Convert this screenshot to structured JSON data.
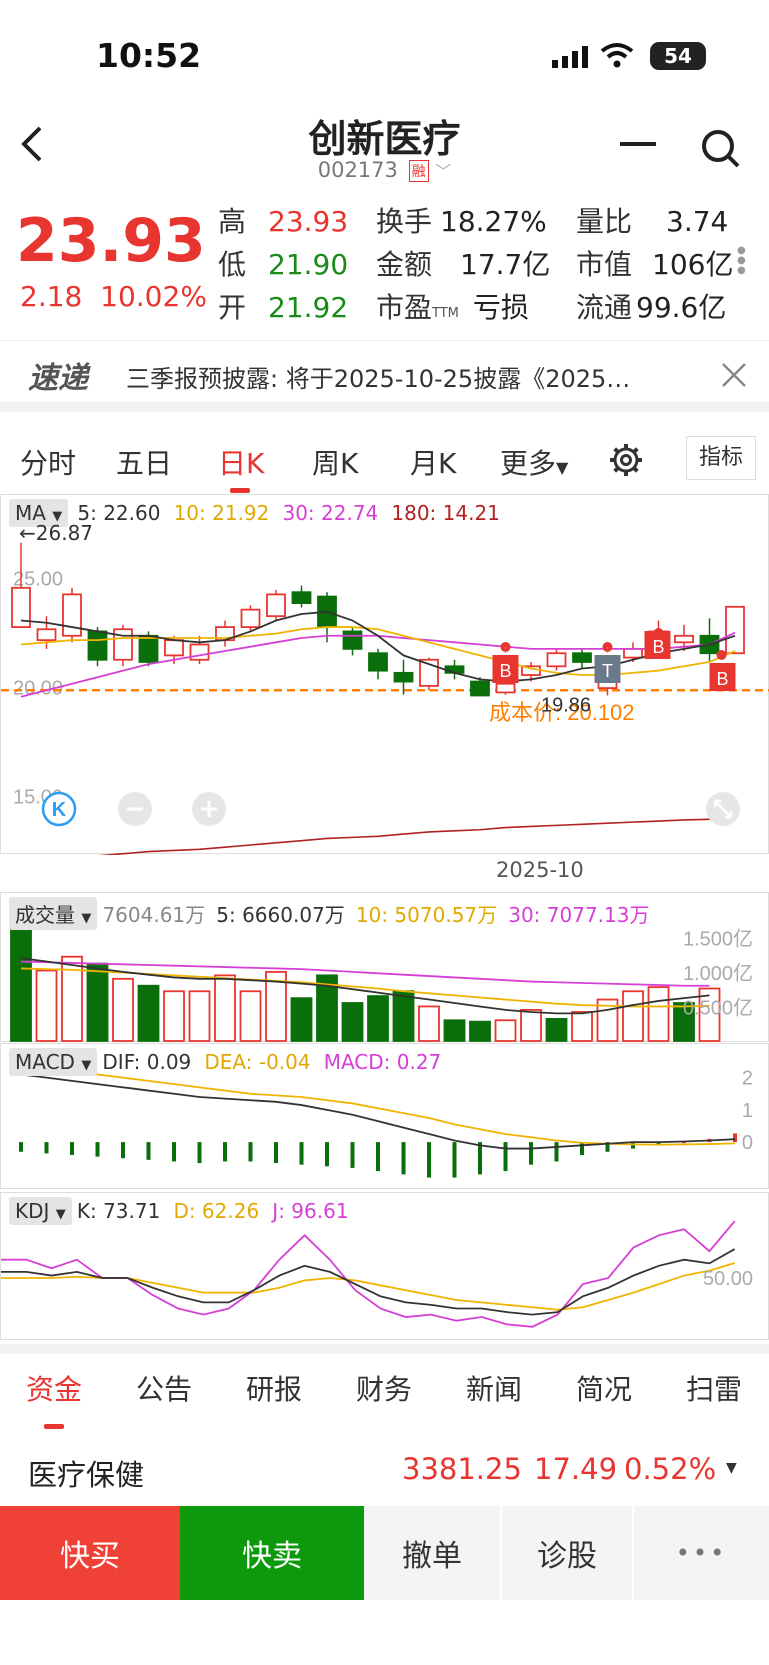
{
  "status_bar": {
    "time": "10:52",
    "battery": "54"
  },
  "header": {
    "title": "创新医疗",
    "code": "002173",
    "tag": "融",
    "back_icon": "chevron-left-icon",
    "minus_icon": "minus-icon",
    "search_icon": "search-icon"
  },
  "quote": {
    "price": "23.93",
    "change": "2.18",
    "change_pct": "10.02%",
    "items": [
      {
        "label": "高",
        "value": "23.93"
      },
      {
        "label": "低",
        "value": "21.90"
      },
      {
        "label": "开",
        "value": "21.92"
      },
      {
        "label": "换手",
        "value": "18.27%"
      },
      {
        "label": "金额",
        "value": "17.7亿"
      },
      {
        "label": "市盈",
        "sub": "TTM",
        "value": "亏损"
      },
      {
        "label": "量比",
        "value": "3.74"
      },
      {
        "label": "市值",
        "value": "106亿"
      },
      {
        "label": "流通",
        "value": "99.6亿"
      }
    ]
  },
  "banner": {
    "logo": "速递",
    "text": "三季报预披露: 将于2025-10-25披露《2025…"
  },
  "chart_tabs": [
    "分时",
    "五日",
    "日K",
    "周K",
    "月K",
    "更多"
  ],
  "indicator_button": "指标",
  "ma_legend": {
    "label": "MA",
    "ma5": "5: 22.60",
    "ma10": "10: 21.92",
    "ma30": "30: 22.74",
    "ma180": "180: 14.21"
  },
  "annotations": {
    "high_marker": "26.87",
    "low_marker": "19.86",
    "cost": "成本价: 20.102",
    "b_marker": "B",
    "t_marker": "T",
    "date": "2025-10"
  },
  "vol_legend": {
    "label": "成交量",
    "vol": "7604.61万",
    "ma5": "5: 6660.07万",
    "ma10": "10: 5070.57万",
    "ma30": "30: 7077.13万"
  },
  "macd_legend": {
    "label": "MACD",
    "dif": "DIF: 0.09",
    "dea": "DEA: -0.04",
    "macd": "MACD: 0.27"
  },
  "kdj_legend": {
    "label": "KDJ",
    "k": "K: 73.71",
    "d": "D: 62.26",
    "j": "J: 96.61"
  },
  "bottom_tabs": [
    "资金",
    "公告",
    "研报",
    "财务",
    "新闻",
    "简况",
    "扫雷"
  ],
  "sector": {
    "name": "医疗保健",
    "price": "3381.25",
    "change": "17.49",
    "pct": "0.52%"
  },
  "actions": {
    "buy": "快买",
    "sell": "快卖",
    "cancel": "撤单",
    "diagnose": "诊股",
    "more": "•••"
  },
  "colors": {
    "up": "#e8352f",
    "down": "#0a6e0a",
    "ma5": "#333333",
    "ma10": "#f0b400",
    "ma30": "#d63fd6",
    "ma180": "#b22222",
    "cost": "#ff7f00"
  },
  "chart_data": [
    {
      "type": "candlestick",
      "title": "",
      "y_ticks": [
        "25.00",
        "20.00",
        "15.00"
      ],
      "ylim": [
        13.0,
        27.5
      ],
      "x_label": "2025-10",
      "candles": [
        [
          23.0,
          24.8,
          23.1,
          26.87
        ],
        [
          22.4,
          22.9,
          22.0,
          23.5
        ],
        [
          22.6,
          24.5,
          22.3,
          24.8
        ],
        [
          22.8,
          21.5,
          21.2,
          23.0
        ],
        [
          21.5,
          22.9,
          21.2,
          23.1
        ],
        [
          22.6,
          21.4,
          21.2,
          22.8
        ],
        [
          21.7,
          22.4,
          21.3,
          22.6
        ],
        [
          21.5,
          22.2,
          21.3,
          22.6
        ],
        [
          22.4,
          23.0,
          22.1,
          23.3
        ],
        [
          23.0,
          23.8,
          22.8,
          24.0
        ],
        [
          23.5,
          24.5,
          23.3,
          24.7
        ],
        [
          24.6,
          24.1,
          23.9,
          24.9
        ],
        [
          24.4,
          23.0,
          22.3,
          24.6
        ],
        [
          22.8,
          22.0,
          21.7,
          23.0
        ],
        [
          21.8,
          21.0,
          20.6,
          22.0
        ],
        [
          20.9,
          20.5,
          19.9,
          21.5
        ],
        [
          20.3,
          21.5,
          20.1,
          21.6
        ],
        [
          21.2,
          20.9,
          20.6,
          21.5
        ],
        [
          20.5,
          19.86,
          19.86,
          20.7
        ],
        [
          20.0,
          20.4,
          19.9,
          20.5
        ],
        [
          20.8,
          21.2,
          20.5,
          21.4
        ],
        [
          21.2,
          21.8,
          21.0,
          22.0
        ],
        [
          21.8,
          21.4,
          21.1,
          22.0
        ],
        [
          20.2,
          21.5,
          19.86,
          21.6
        ],
        [
          21.6,
          22.0,
          21.4,
          22.3
        ],
        [
          22.0,
          22.8,
          21.8,
          23.3
        ],
        [
          22.3,
          22.6,
          21.9,
          23.1
        ],
        [
          22.6,
          21.8,
          21.4,
          23.4
        ],
        [
          21.8,
          23.93,
          21.9,
          23.93
        ]
      ],
      "ma5": [
        23.3,
        23.2,
        23.0,
        22.8,
        22.6,
        22.6,
        22.4,
        22.3,
        22.4,
        22.8,
        23.3,
        23.6,
        23.7,
        23.3,
        22.6,
        21.7,
        21.3,
        20.9,
        20.6,
        20.5,
        20.6,
        20.8,
        21.1,
        21.2,
        21.5,
        21.8,
        22.0,
        22.2,
        22.6
      ],
      "ma10": [
        22.2,
        22.3,
        22.4,
        22.4,
        22.5,
        22.5,
        22.5,
        22.5,
        22.5,
        22.6,
        22.7,
        22.9,
        23.0,
        23.0,
        22.9,
        22.6,
        22.3,
        22.0,
        21.7,
        21.4,
        21.1,
        20.9,
        20.8,
        20.8,
        20.9,
        21.0,
        21.2,
        21.4,
        21.9
      ],
      "ma30": [
        19.8,
        20.1,
        20.4,
        20.7,
        21.0,
        21.3,
        21.5,
        21.7,
        21.9,
        22.1,
        22.3,
        22.5,
        22.6,
        22.6,
        22.6,
        22.5,
        22.4,
        22.3,
        22.2,
        22.1,
        22.0,
        22.0,
        22.0,
        22.0,
        22.0,
        22.0,
        22.1,
        22.2,
        22.74
      ],
      "ma180": [
        12.2,
        12.3,
        12.4,
        12.5,
        12.6,
        12.7,
        12.75,
        12.8,
        12.9,
        13.0,
        13.1,
        13.2,
        13.3,
        13.35,
        13.4,
        13.5,
        13.6,
        13.65,
        13.7,
        13.8,
        13.85,
        13.9,
        13.95,
        14.0,
        14.05,
        14.1,
        14.15,
        14.18,
        14.21
      ]
    },
    {
      "type": "bar",
      "title": "",
      "y_ticks": [
        "1.500亿",
        "1.000亿",
        "0.500亿"
      ],
      "ylim": [
        0,
        1.65
      ],
      "values_yi": [
        1.62,
        1.02,
        1.22,
        1.12,
        0.9,
        0.8,
        0.72,
        0.72,
        0.95,
        0.72,
        1.0,
        0.62,
        0.95,
        0.55,
        0.65,
        0.72,
        0.5,
        0.3,
        0.28,
        0.3,
        0.45,
        0.32,
        0.42,
        0.6,
        0.72,
        0.78,
        0.55,
        0.76
      ],
      "directions": [
        "down",
        "up",
        "up",
        "down",
        "up",
        "down",
        "up",
        "up",
        "up",
        "up",
        "up",
        "down",
        "down",
        "down",
        "down",
        "down",
        "up",
        "down",
        "down",
        "up",
        "up",
        "down",
        "up",
        "up",
        "up",
        "up",
        "down",
        "up"
      ],
      "ma5": [
        1.2,
        1.15,
        1.1,
        1.05,
        1.0,
        0.96,
        0.92,
        0.9,
        0.9,
        0.88,
        0.86,
        0.83,
        0.8,
        0.75,
        0.7,
        0.65,
        0.6,
        0.55,
        0.5,
        0.45,
        0.42,
        0.4,
        0.4,
        0.45,
        0.52,
        0.58,
        0.62,
        0.66
      ],
      "ma10": [
        1.05,
        1.04,
        1.03,
        1.01,
        0.99,
        0.97,
        0.95,
        0.93,
        0.91,
        0.89,
        0.87,
        0.85,
        0.82,
        0.79,
        0.76,
        0.72,
        0.69,
        0.66,
        0.63,
        0.6,
        0.57,
        0.54,
        0.52,
        0.51,
        0.5,
        0.5,
        0.5,
        0.51
      ],
      "ma30": [
        1.15,
        1.14,
        1.13,
        1.12,
        1.11,
        1.1,
        1.09,
        1.08,
        1.07,
        1.06,
        1.05,
        1.04,
        1.02,
        1.0,
        0.98,
        0.96,
        0.94,
        0.92,
        0.9,
        0.88,
        0.86,
        0.85,
        0.84,
        0.83,
        0.82,
        0.81,
        0.8,
        0.8
      ]
    },
    {
      "type": "bar",
      "title": "",
      "y_ticks": [
        "2",
        "1",
        "0"
      ],
      "ylim": [
        -1.3,
        2.3
      ],
      "macd": [
        -0.3,
        -0.35,
        -0.4,
        -0.45,
        -0.5,
        -0.55,
        -0.6,
        -0.65,
        -0.6,
        -0.6,
        -0.65,
        -0.7,
        -0.75,
        -0.8,
        -0.9,
        -1.0,
        -1.1,
        -1.1,
        -1.0,
        -0.9,
        -0.7,
        -0.6,
        -0.4,
        -0.3,
        -0.2,
        -0.1,
        0.0,
        0.1,
        0.27
      ],
      "dif": [
        2.1,
        2.0,
        1.9,
        1.8,
        1.7,
        1.6,
        1.5,
        1.4,
        1.35,
        1.3,
        1.25,
        1.15,
        1.0,
        0.85,
        0.65,
        0.45,
        0.25,
        0.05,
        -0.1,
        -0.2,
        -0.2,
        -0.15,
        -0.1,
        -0.05,
        0.0,
        0.0,
        0.02,
        0.05,
        0.09
      ],
      "dea": [
        2.4,
        2.3,
        2.2,
        2.1,
        2.0,
        1.9,
        1.8,
        1.7,
        1.6,
        1.5,
        1.45,
        1.4,
        1.3,
        1.2,
        1.05,
        0.9,
        0.75,
        0.55,
        0.4,
        0.25,
        0.15,
        0.05,
        -0.02,
        -0.05,
        -0.07,
        -0.08,
        -0.07,
        -0.06,
        -0.04
      ]
    },
    {
      "type": "line",
      "title": "",
      "y_ticks": [
        "50.00"
      ],
      "ylim": [
        0,
        100
      ],
      "k": [
        55,
        55,
        52,
        55,
        50,
        50,
        42,
        35,
        30,
        30,
        40,
        52,
        60,
        55,
        45,
        35,
        30,
        28,
        25,
        25,
        22,
        20,
        22,
        35,
        42,
        52,
        60,
        65,
        62,
        73.71
      ],
      "d": [
        50,
        50,
        50,
        51,
        50,
        50,
        46,
        42,
        38,
        38,
        38,
        42,
        48,
        50,
        48,
        44,
        40,
        36,
        32,
        30,
        28,
        26,
        24,
        26,
        32,
        38,
        45,
        52,
        56,
        62.26
      ],
      "j": [
        65,
        65,
        58,
        65,
        50,
        50,
        36,
        25,
        20,
        25,
        40,
        65,
        85,
        65,
        40,
        25,
        18,
        20,
        15,
        18,
        12,
        10,
        20,
        45,
        50,
        75,
        85,
        90,
        72,
        96.61
      ]
    }
  ]
}
